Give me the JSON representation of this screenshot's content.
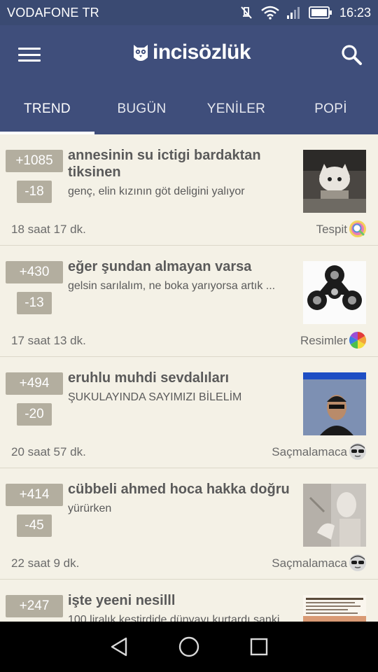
{
  "status_bar": {
    "carrier": "VODAFONE TR",
    "time": "16:23",
    "icons": [
      "mute-icon",
      "wifi-icon",
      "signal-icon",
      "battery-icon"
    ]
  },
  "app_bar": {
    "logo_text": "incisözlük",
    "menu_icon": "hamburger-icon",
    "search_icon": "search-icon"
  },
  "tabs": [
    {
      "label": "TREND",
      "active": true
    },
    {
      "label": "BUGÜN",
      "active": false
    },
    {
      "label": "YENİLER",
      "active": false
    },
    {
      "label": "POPİ",
      "active": false
    }
  ],
  "entries": [
    {
      "up": "+1085",
      "down": "-18",
      "title": "annesinin su ictigi bardaktan tiksinen",
      "desc": "genç, elin kızının göt deligini yalıyor",
      "time": "18 saat 17 dk.",
      "category": "Tespit",
      "category_icon": "magnifier-badge-icon"
    },
    {
      "up": "+430",
      "down": "-13",
      "title": "eğer şundan almayan varsa",
      "desc": "gelsin sarılalım, ne boka yarıyorsa artık ...",
      "time": "17 saat 13 dk.",
      "category": "Resimler",
      "category_icon": "color-wheel-icon"
    },
    {
      "up": "+494",
      "down": "-20",
      "title": "eruhlu muhdi sevdalıları",
      "desc": "ŞUKULAYINDA SAYIMIZI BİLELİM",
      "time": "20 saat 57 dk.",
      "category": "Saçmalamaca",
      "category_icon": "sunglasses-face-icon"
    },
    {
      "up": "+414",
      "down": "-45",
      "title": "cübbeli ahmed hoca hakka doğru",
      "desc": "yürürken",
      "time": "22 saat 9 dk.",
      "category": "Saçmalamaca",
      "category_icon": "sunglasses-face-icon"
    },
    {
      "up": "+247",
      "down": "",
      "title": "işte yeeni nesilll",
      "desc": "100 liralık kestirdide dünyayı kurtardı sanki",
      "time": "",
      "category": "",
      "category_icon": ""
    }
  ],
  "nav_bar": {
    "back_icon": "back-triangle-icon",
    "home_icon": "home-circle-icon",
    "recents_icon": "recents-square-icon"
  }
}
